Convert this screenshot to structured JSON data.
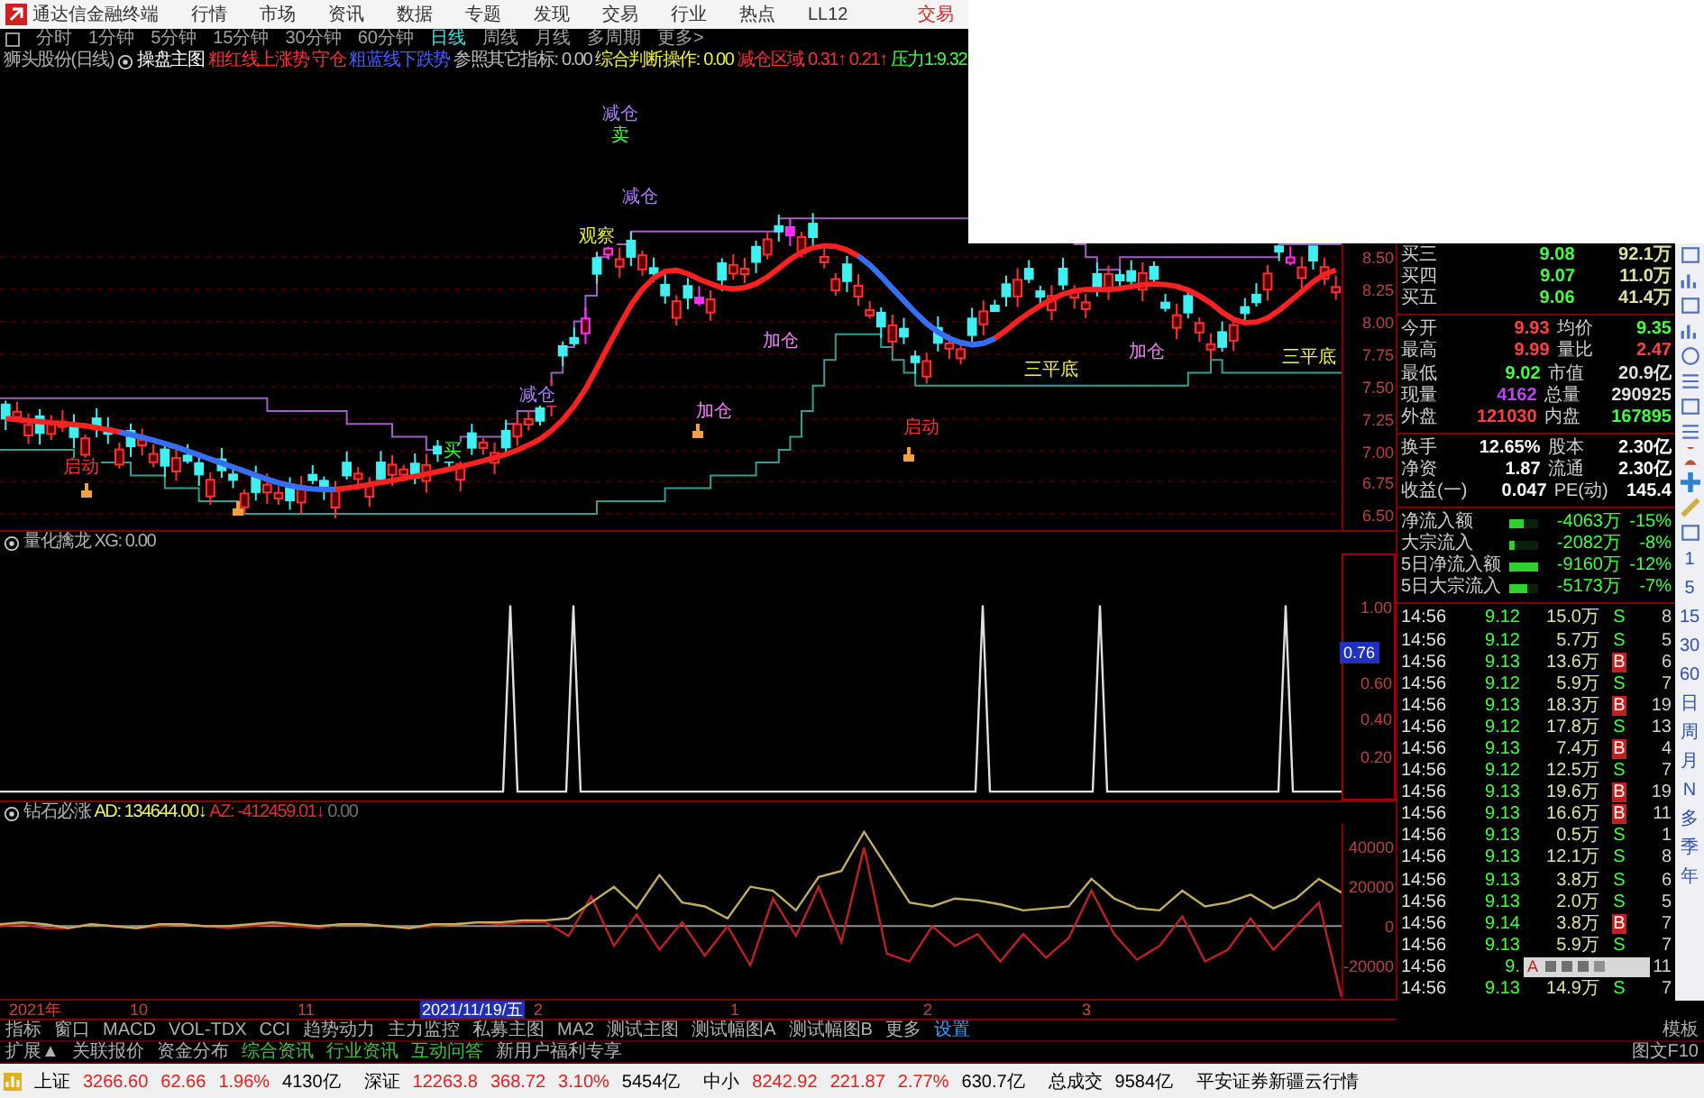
{
  "app": {
    "title": "通达信金融终端",
    "menu": [
      "行情",
      "市场",
      "资讯",
      "数据",
      "专题",
      "发现",
      "交易",
      "行业",
      "热点",
      "LL12"
    ],
    "trade_button": "交易"
  },
  "periods": [
    {
      "label": "分时",
      "selected": false
    },
    {
      "label": "1分钟",
      "selected": false
    },
    {
      "label": "5分钟",
      "selected": false
    },
    {
      "label": "15分钟",
      "selected": false
    },
    {
      "label": "30分钟",
      "selected": false
    },
    {
      "label": "60分钟",
      "selected": false
    },
    {
      "label": "日线",
      "selected": true
    },
    {
      "label": "周线",
      "selected": false
    },
    {
      "label": "月线",
      "selected": false
    },
    {
      "label": "多周期",
      "selected": false
    },
    {
      "label": "更多>",
      "selected": false
    }
  ],
  "main_chart": {
    "stock": "狮头股份(日线)",
    "indicator": "操盘主图",
    "legend": [
      {
        "text": "粗红线上涨势",
        "color": "#ff3030"
      },
      {
        "text": "守仓",
        "color": "#ff3030"
      },
      {
        "text": "粗蓝线下跌势",
        "color": "#4060ff"
      },
      {
        "text": "参照其它指标: 0.00",
        "color": "#c0c0c0"
      },
      {
        "text": "综合判断操作: 0.00",
        "color": "#f0f040"
      },
      {
        "text": "减仓区域",
        "color": "#ff3030"
      },
      {
        "text": "0.31↑",
        "color": "#ff3030"
      },
      {
        "text": "0.21↑",
        "color": "#ff3030"
      },
      {
        "text": "压力1:9.32",
        "color": "#40ff40"
      }
    ],
    "axis": [
      "8.50",
      "8.25",
      "8.00",
      "7.75",
      "7.50",
      "7.25",
      "7.00",
      "6.75",
      "6.50"
    ],
    "labels": [
      {
        "text": "减仓",
        "color": "#b080ff"
      },
      {
        "text": "卖",
        "color": "#40ff40"
      },
      {
        "text": "减仓",
        "color": "#b080ff"
      },
      {
        "text": "观察",
        "color": "#f0f040"
      },
      {
        "text": "加仓",
        "color": "#ff80ff"
      },
      {
        "text": "三平底",
        "color": "#f0f040"
      },
      {
        "text": "加仓",
        "color": "#ff80ff"
      },
      {
        "text": "三平底",
        "color": "#f0f040"
      },
      {
        "text": "减仓",
        "color": "#b080ff"
      },
      {
        "text": "加仓",
        "color": "#ff80ff"
      },
      {
        "text": "启动",
        "color": "#ff3030"
      },
      {
        "text": "买",
        "color": "#40ff40"
      },
      {
        "text": "启动",
        "color": "#ff3030"
      }
    ]
  },
  "signal_panel": {
    "name": "量化擒龙",
    "value": "XG: 0.00",
    "axis": [
      {
        "text": "1.00",
        "current": false
      },
      {
        "text": "0.76",
        "current": true
      },
      {
        "text": "0.60",
        "current": false
      },
      {
        "text": "0.40",
        "current": false
      },
      {
        "text": "0.20",
        "current": false
      }
    ]
  },
  "ad_panel": {
    "name": "钻石必涨",
    "readings": [
      ": 134644.00↓",
      ": -412459.01↓"
    ],
    "extra": "0.00",
    "chart_data": {
      "type": "line",
      "ylim": [
        -37000,
        52000
      ],
      "yticks": [
        -20000,
        0,
        20000,
        40000
      ],
      "series": [
        {
          "name": "AD",
          "color": "#c0b060",
          "values": [
            1000,
            2000,
            1000,
            -1000,
            1000,
            0,
            -1000,
            1000,
            1000,
            0,
            0,
            1000,
            2000,
            1000,
            0,
            1000,
            1000,
            0,
            -1000,
            1000,
            1000,
            2000,
            2000,
            3000,
            3000,
            4000,
            12000,
            20000,
            9000,
            26000,
            12000,
            10000,
            4000,
            20000,
            18000,
            8000,
            25000,
            28000,
            48000,
            30000,
            12000,
            10000,
            14000,
            13000,
            11000,
            8000,
            9000,
            10000,
            24000,
            14000,
            9000,
            8000,
            18000,
            10000,
            12000,
            16000,
            9000,
            14000,
            24000,
            17000
          ]
        },
        {
          "name": "AZ",
          "color": "#c02020",
          "values": [
            0,
            1000,
            -1000,
            -1000,
            1000,
            0,
            -1000,
            0,
            1000,
            0,
            -1000,
            0,
            1000,
            0,
            -1000,
            1000,
            1000,
            0,
            -1000,
            0,
            1000,
            2000,
            1000,
            2000,
            2000,
            -5000,
            15000,
            -10000,
            6000,
            -12000,
            2000,
            -15000,
            0,
            -20000,
            14000,
            -5000,
            20000,
            -8000,
            40000,
            -14000,
            -18000,
            0,
            -10000,
            -4000,
            -18000,
            -4000,
            -16000,
            -6000,
            18000,
            -4000,
            -17000,
            -10000,
            5000,
            -18000,
            -12000,
            4000,
            -12000,
            0,
            12000,
            -36000
          ]
        }
      ]
    }
  },
  "date_axis": [
    {
      "text": "2021年",
      "selected": false
    },
    {
      "text": "10",
      "selected": false
    },
    {
      "text": "11",
      "selected": false
    },
    {
      "text": "2021/11/19/五",
      "selected": true
    },
    {
      "text": "2",
      "selected": false
    },
    {
      "text": "1",
      "selected": false
    },
    {
      "text": "2",
      "selected": false
    },
    {
      "text": "3",
      "selected": false
    }
  ],
  "order_book": [
    {
      "label": "买三",
      "price": "9.08",
      "volume": "92.1万"
    },
    {
      "label": "买四",
      "price": "9.07",
      "volume": "11.0万"
    },
    {
      "label": "买五",
      "price": "9.06",
      "volume": "41.4万"
    }
  ],
  "stats": [
    [
      {
        "label": "今开",
        "value": "9.93",
        "color": "#ff4040"
      },
      {
        "label": "均价",
        "value": "9.35",
        "color": "#40ff40"
      }
    ],
    [
      {
        "label": "最高",
        "value": "9.99",
        "color": "#ff4040"
      },
      {
        "label": "量比",
        "value": "2.47",
        "color": "#ff4040"
      }
    ],
    [
      {
        "label": "最低",
        "value": "9.02",
        "color": "#40ff40"
      },
      {
        "label": "市值",
        "value": "20.9亿",
        "color": "#e0e0e0"
      }
    ],
    [
      {
        "label": "现量",
        "value": "4162",
        "color": "#c040ff"
      },
      {
        "label": "总量",
        "value": "290925",
        "color": "#e0e0e0"
      }
    ],
    [
      {
        "label": "外盘",
        "value": "121030",
        "color": "#ff4040"
      },
      {
        "label": "内盘",
        "value": "167895",
        "color": "#40ff40"
      }
    ]
  ],
  "stats2": [
    {
      "label": "换手",
      "value": "12.65%",
      "label2": "股本",
      "value2": "2.30亿"
    },
    {
      "label": "净资",
      "value": "1.87",
      "label2": "流通",
      "value2": "2.30亿"
    },
    {
      "label": "收益(一)",
      "value": "0.047",
      "label2": "PE(动)",
      "value2": "145.4"
    }
  ],
  "flows": [
    {
      "label": "净流入额",
      "level": 0.5,
      "amount": "-4063万",
      "pct": "-15%"
    },
    {
      "label": "大宗流入",
      "level": 0.2,
      "amount": "-2082万",
      "pct": "-8%"
    },
    {
      "label": "5日净流入额",
      "level": 1,
      "amount": "-9160万",
      "pct": "-12%"
    },
    {
      "label": "5日大宗流入",
      "level": 0.6,
      "amount": "-5173万",
      "pct": "-7%"
    }
  ],
  "ticks": [
    {
      "time": "14:56",
      "price": "9.12",
      "volume": "15.0万",
      "side": "S",
      "kind": "sell",
      "count": "8"
    },
    {
      "time": "14:56",
      "price": "9.12",
      "volume": "5.7万",
      "side": "S",
      "kind": "sell",
      "count": "5"
    },
    {
      "time": "14:56",
      "price": "9.13",
      "volume": "13.6万",
      "side": "B",
      "kind": "buy",
      "count": "6"
    },
    {
      "time": "14:56",
      "price": "9.12",
      "volume": "5.9万",
      "side": "S",
      "kind": "sell",
      "count": "7"
    },
    {
      "time": "14:56",
      "price": "9.13",
      "volume": "18.3万",
      "side": "B",
      "kind": "buy",
      "count": "19"
    },
    {
      "time": "14:56",
      "price": "9.12",
      "volume": "17.8万",
      "side": "S",
      "kind": "sell",
      "count": "13"
    },
    {
      "time": "14:56",
      "price": "9.13",
      "volume": "7.4万",
      "side": "B",
      "kind": "buy",
      "count": "4"
    },
    {
      "time": "14:56",
      "price": "9.12",
      "volume": "12.5万",
      "side": "S",
      "kind": "sell",
      "count": "7"
    },
    {
      "time": "14:56",
      "price": "9.13",
      "volume": "19.6万",
      "side": "B",
      "kind": "buy",
      "count": "19"
    },
    {
      "time": "14:56",
      "price": "9.13",
      "volume": "16.6万",
      "side": "B",
      "kind": "buy",
      "count": "11"
    },
    {
      "time": "14:56",
      "price": "9.13",
      "volume": "0.5万",
      "side": "S",
      "kind": "sell",
      "count": "1"
    },
    {
      "time": "14:56",
      "price": "9.13",
      "volume": "12.1万",
      "side": "S",
      "kind": "sell",
      "count": "8"
    },
    {
      "time": "14:56",
      "price": "9.13",
      "volume": "3.8万",
      "side": "S",
      "kind": "sell",
      "count": "6"
    },
    {
      "time": "14:56",
      "price": "9.13",
      "volume": "2.0万",
      "side": "S",
      "kind": "sell",
      "count": "5"
    },
    {
      "time": "14:56",
      "price": "9.14",
      "volume": "3.8万",
      "side": "B",
      "kind": "buy",
      "count": "7"
    },
    {
      "time": "14:56",
      "price": "9.13",
      "volume": "5.9万",
      "side": "S",
      "kind": "sell",
      "count": "7"
    },
    {
      "time": "14:56",
      "price": "9.",
      "count": "11"
    },
    {
      "time": "14:56",
      "price": "9.13",
      "volume": "14.9万",
      "side": "S",
      "kind": "sell",
      "count": "7"
    }
  ],
  "ime_bar": {
    "letter": "A"
  },
  "side_periods": [
    "1",
    "5",
    "15",
    "30",
    "60",
    "日",
    "周",
    "月",
    "N",
    "多",
    "季",
    "年"
  ],
  "tabs": [
    "指标",
    "窗口",
    "MACD",
    "VOL-TDX",
    "CCI",
    "趋势动力",
    "主力监控",
    "私募主图",
    "MA2",
    "测试主图",
    "测试幅图A",
    "测试幅图B",
    "更多"
  ],
  "settings_tab": "设置",
  "template_button": "模板",
  "tabs2": [
    {
      "label": "扩展▲",
      "highlight": false
    },
    {
      "label": "关联报价",
      "highlight": false
    },
    {
      "label": "资金分布",
      "highlight": false
    },
    {
      "label": "综合资讯",
      "highlight": true
    },
    {
      "label": "行业资讯",
      "highlight": true
    },
    {
      "label": "互动问答",
      "highlight": true
    },
    {
      "label": "新用户福利专享",
      "highlight": false
    }
  ],
  "f10_button": "图文F10",
  "status": [
    {
      "name": "上证",
      "value": "3266.60",
      "change": "62.66",
      "pct": "1.96%",
      "amount": "4130亿"
    },
    {
      "name": "深证",
      "value": "12263.8",
      "change": "368.72",
      "pct": "3.10%",
      "amount": "5454亿"
    },
    {
      "name": "中小",
      "value": "8242.92",
      "change": "221.87",
      "pct": "2.77%",
      "amount": "630.7亿"
    }
  ],
  "total_label": "总成交",
  "total": "9584亿",
  "broker": "平安证券新疆云行情"
}
